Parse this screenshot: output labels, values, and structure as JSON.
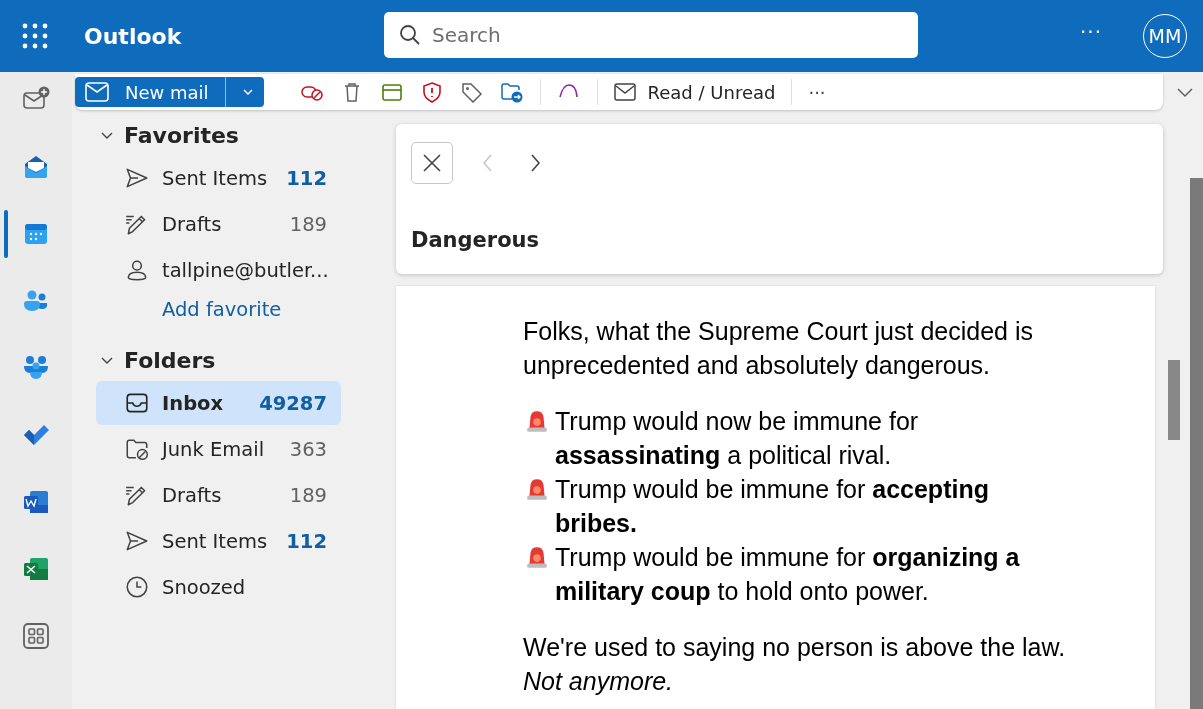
{
  "header": {
    "app_title": "Outlook",
    "search": {
      "placeholder": "Search"
    },
    "more": "···",
    "avatar": "MM"
  },
  "rail": [
    {
      "kind": "compose",
      "selected": false
    },
    {
      "kind": "mail",
      "selected": false
    },
    {
      "kind": "calendar",
      "selected": true
    },
    {
      "kind": "people",
      "selected": false
    },
    {
      "kind": "groups",
      "selected": false
    },
    {
      "kind": "todo",
      "selected": false
    },
    {
      "kind": "word",
      "selected": false
    },
    {
      "kind": "excel",
      "selected": false
    },
    {
      "kind": "apps",
      "selected": false
    }
  ],
  "ribbon": {
    "new_mail": "New mail",
    "read_unread": "Read / Unread",
    "more": "···"
  },
  "favorites": {
    "title": "Favorites",
    "expanded": true,
    "items": [
      {
        "kind": "sent",
        "label": "Sent Items",
        "count": "112",
        "unread": true,
        "selected": false
      },
      {
        "kind": "drafts",
        "label": "Drafts",
        "count": "189",
        "unread": false,
        "selected": false
      },
      {
        "kind": "account",
        "label": "tallpine@butler...",
        "selected": false
      }
    ],
    "add_favorite": "Add favorite"
  },
  "folders": {
    "title": "Folders",
    "expanded": true,
    "items": [
      {
        "kind": "inbox",
        "label": "Inbox",
        "count": "49287",
        "unread": true,
        "selected": true
      },
      {
        "kind": "junk",
        "label": "Junk Email",
        "count": "363",
        "unread": false,
        "selected": false
      },
      {
        "kind": "drafts",
        "label": "Drafts",
        "count": "189",
        "unread": false,
        "selected": false
      },
      {
        "kind": "sent",
        "label": "Sent Items",
        "count": "112",
        "unread": true,
        "selected": false
      },
      {
        "kind": "snoozed",
        "label": "Snoozed",
        "selected": false
      }
    ]
  },
  "message": {
    "subject": "Dangerous",
    "body": [
      {
        "kind": "text",
        "text": "Folks, what the Supreme Court just decided is unprecedented and absolutely dangerous."
      },
      {
        "kind": "alerts",
        "lines": [
          "Trump would now be immune for **assassinating** a political rival.",
          "Trump would be immune for **accepting bribes.**",
          "Trump would be immune for **organizing a military coup** to hold onto power."
        ]
      },
      {
        "kind": "text",
        "text": "We're used to saying no person is above the law. *Not anymore.*"
      }
    ]
  }
}
